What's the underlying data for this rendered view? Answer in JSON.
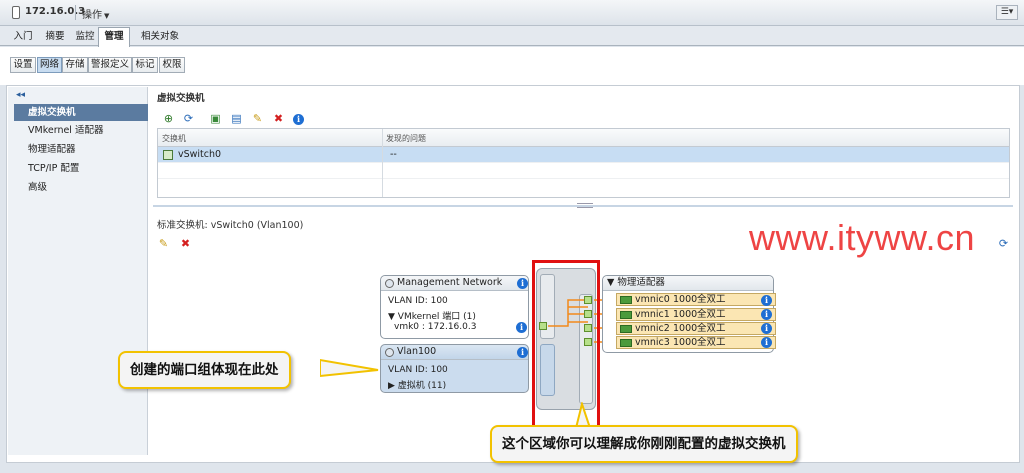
{
  "titlebar": {
    "host": "172.16.0.3",
    "actions_label": "操作",
    "menu_glyph": "☰▾"
  },
  "tabs": [
    {
      "label": "入门",
      "active": false
    },
    {
      "label": "摘要",
      "active": false
    },
    {
      "label": "监控",
      "active": false
    },
    {
      "label": "管理",
      "active": true
    },
    {
      "label": "相关对象",
      "active": false
    }
  ],
  "subtabs": [
    {
      "label": "设置",
      "active": false
    },
    {
      "label": "网络",
      "active": true
    },
    {
      "label": "存储",
      "active": false
    },
    {
      "label": "警报定义",
      "active": false
    },
    {
      "label": "标记",
      "active": false
    },
    {
      "label": "权限",
      "active": false
    }
  ],
  "leftnav": {
    "collapse_glyph": "◂◂",
    "items": [
      {
        "label": "虚拟交换机",
        "active": true
      },
      {
        "label": "VMkernel 适配器",
        "active": false
      },
      {
        "label": "物理适配器",
        "active": false
      },
      {
        "label": "TCP/IP 配置",
        "active": false
      },
      {
        "label": "高级",
        "active": false
      }
    ]
  },
  "vswitch_section": {
    "title": "虚拟交换机",
    "columns": [
      "交换机",
      "发现的问题"
    ],
    "rows": [
      {
        "name": "vSwitch0",
        "issue": "--",
        "selected": true
      }
    ]
  },
  "detail": {
    "title": "标准交换机: vSwitch0 (Vlan100)",
    "mgmt_group": {
      "name": "Management Network",
      "vlan": "VLAN ID: 100",
      "vmkernel_ports": "VMkernel 端口 (1)",
      "vmk": "vmk0 : 172.16.0.3"
    },
    "vlan_group": {
      "name": "Vlan100",
      "vlan": "VLAN ID: 100",
      "vms": "虚拟机 (11)"
    },
    "physical_adapters": {
      "title": "物理适配器",
      "nics": [
        {
          "name": "vmnic0",
          "speed": "1000",
          "duplex": "全双工"
        },
        {
          "name": "vmnic1",
          "speed": "1000",
          "duplex": "全双工"
        },
        {
          "name": "vmnic2",
          "speed": "1000",
          "duplex": "全双工"
        },
        {
          "name": "vmnic3",
          "speed": "1000",
          "duplex": "全双工"
        }
      ]
    }
  },
  "watermark": "www.ityww.cn",
  "callouts": {
    "portgroup": "创建的端口组体现在此处",
    "vswitch": "这个区域你可以理解成你刚刚配置的虚拟交换机"
  },
  "colors": {
    "accent_nav": "#5b7ba0",
    "selection": "#c7ddf3",
    "nic_bg": "#fbe6b3",
    "link_orange": "#f28a1a",
    "callout_border": "#f2c200",
    "annotation_red": "#e01010"
  }
}
